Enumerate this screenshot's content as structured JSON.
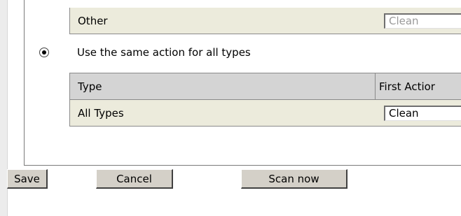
{
  "rows": {
    "other": {
      "label": "Other",
      "action": "Clean"
    },
    "all_types": {
      "label": "All Types",
      "action": "Clean"
    }
  },
  "radio": {
    "label": "Use the same action for all types",
    "selected": true
  },
  "table_header": {
    "type": "Type",
    "first_action": "First Actior"
  },
  "buttons": {
    "save": "Save",
    "cancel": "Cancel",
    "scan_now": "Scan now"
  }
}
